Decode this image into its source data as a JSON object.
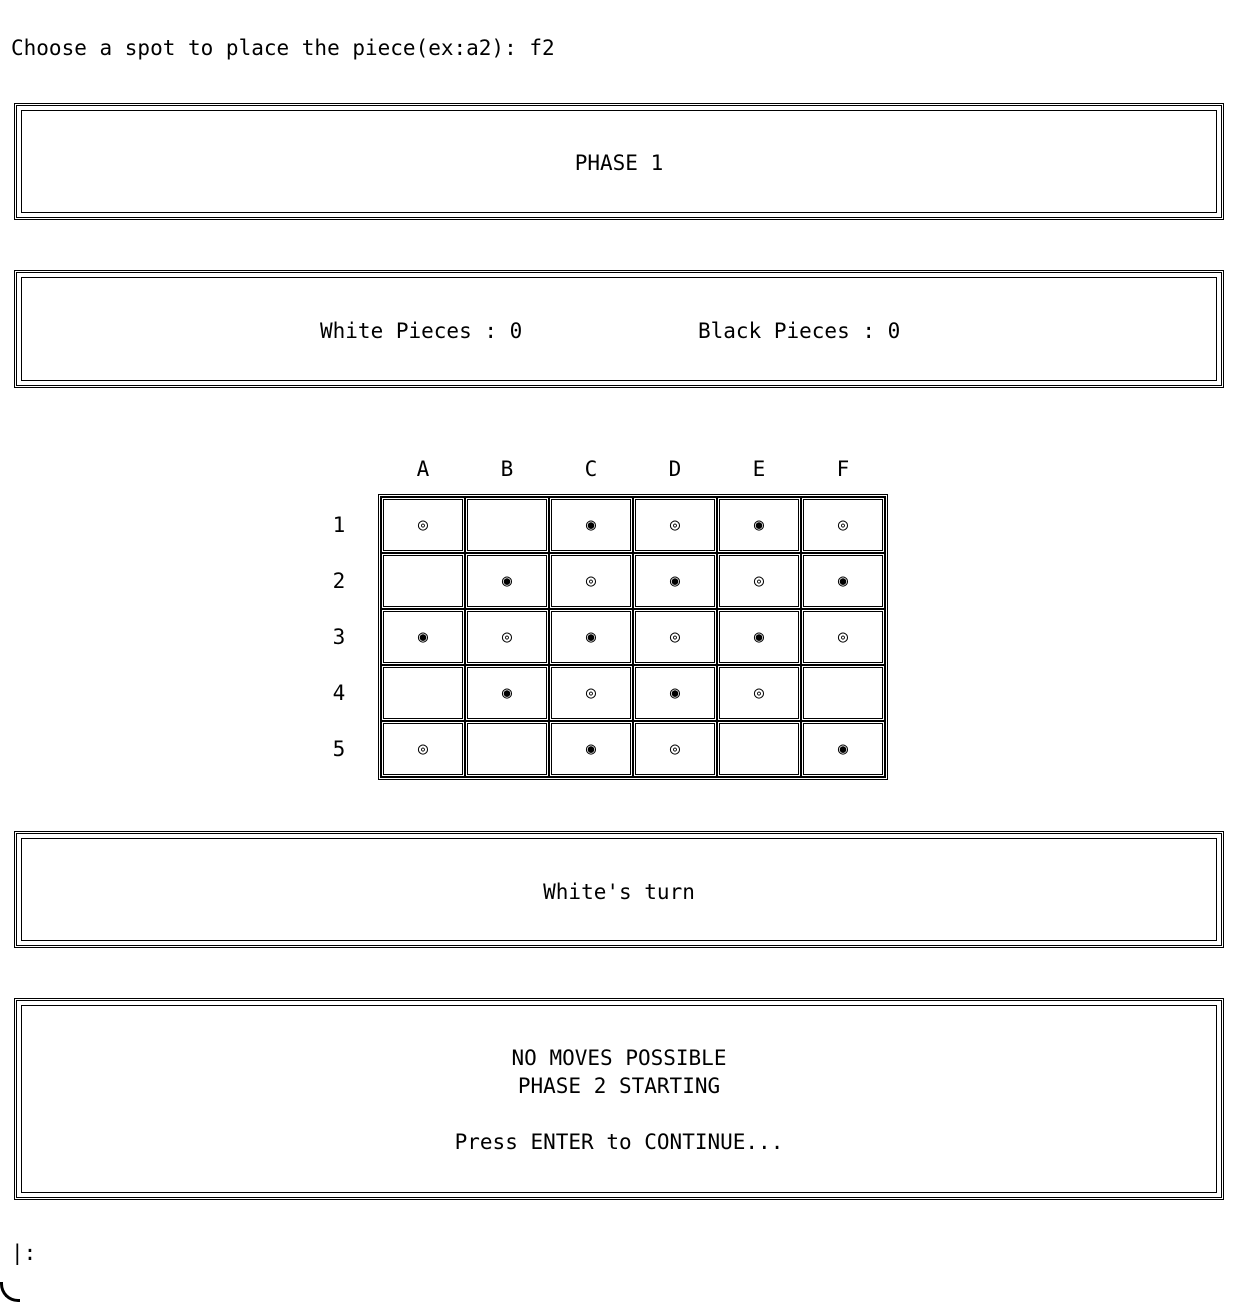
{
  "terminal": {
    "prompt": "Choose a spot to place the piece(ex:a2): f2",
    "input_prompt": "|:"
  },
  "phase_box": {
    "text": "PHASE 1"
  },
  "count_box": {
    "white": "White Pieces : 0",
    "black": "Black Pieces : 0"
  },
  "board": {
    "columns": [
      "A",
      "B",
      "C",
      "D",
      "E",
      "F"
    ],
    "rows": [
      "1",
      "2",
      "3",
      "4",
      "5"
    ],
    "cells": [
      [
        "◎",
        "",
        "◉",
        "◎",
        "◉",
        "◎"
      ],
      [
        "",
        "◉",
        "◎",
        "◉",
        "◎",
        "◉"
      ],
      [
        "◉",
        "◎",
        "◉",
        "◎",
        "◉",
        "◎"
      ],
      [
        "",
        "◉",
        "◎",
        "◉",
        "◎",
        ""
      ],
      [
        "◎",
        "",
        "◉",
        "◎",
        "",
        "◉"
      ]
    ]
  },
  "turn_box": {
    "text": "White's turn"
  },
  "message_box": {
    "line1": "NO MOVES POSSIBLE",
    "line2": "PHASE 2 STARTING",
    "line3": "Press ENTER to CONTINUE..."
  }
}
